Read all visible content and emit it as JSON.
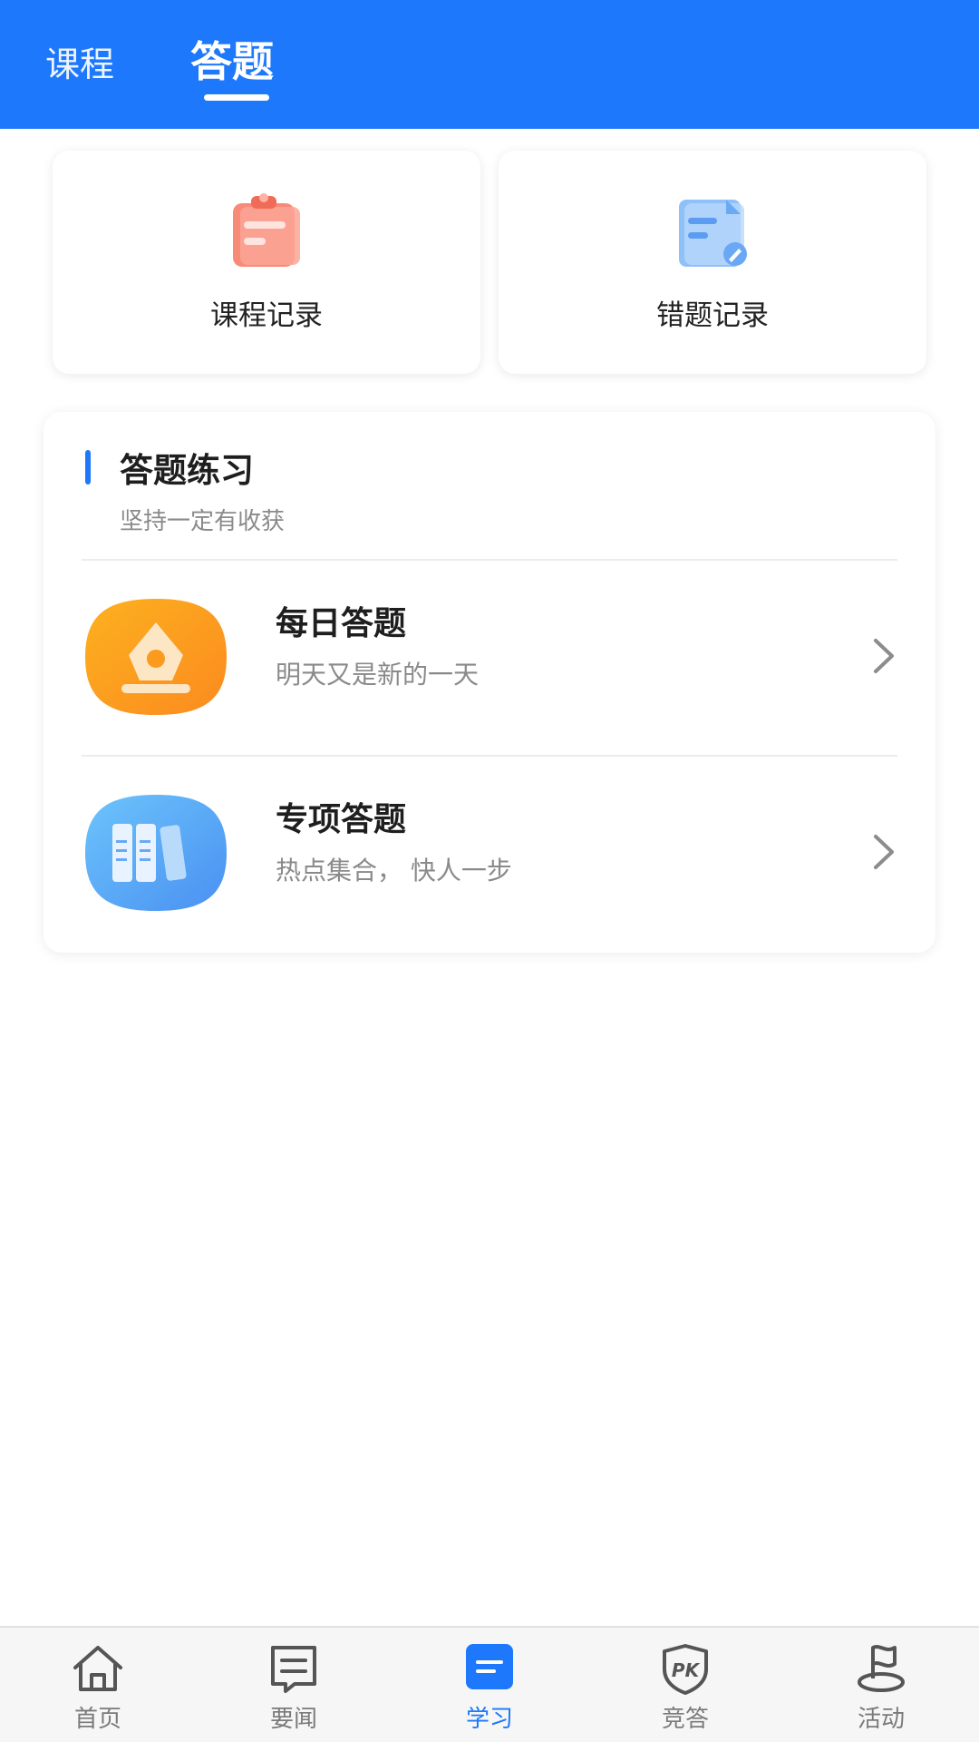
{
  "header": {
    "tabs": [
      {
        "label": "课程",
        "active": false
      },
      {
        "label": "答题",
        "active": true
      }
    ]
  },
  "records": [
    {
      "label": "课程记录",
      "icon": "clipboard-icon"
    },
    {
      "label": "错题记录",
      "icon": "document-edit-icon"
    }
  ],
  "practice": {
    "title": "答题练习",
    "subtitle": "坚持一定有收获",
    "items": [
      {
        "title": "每日答题",
        "desc": "明天又是新的一天",
        "icon": "pen-nib-icon"
      },
      {
        "title": "专项答题",
        "desc": "热点集合， 快人一步",
        "icon": "books-icon"
      }
    ]
  },
  "bottom_nav": {
    "items": [
      {
        "label": "首页",
        "icon": "home-icon",
        "active": false
      },
      {
        "label": "要闻",
        "icon": "news-icon",
        "active": false
      },
      {
        "label": "学习",
        "icon": "study-icon",
        "active": true
      },
      {
        "label": "竞答",
        "icon": "pk-shield-icon",
        "active": false
      },
      {
        "label": "活动",
        "icon": "flag-icon",
        "active": false
      }
    ]
  },
  "colors": {
    "primary": "#1d78fb",
    "text_dark": "#1e1e1e",
    "text_muted": "#8a8a8a",
    "daily_orange": "#fb9a1c",
    "special_blue": "#5aaaf6",
    "record_red": "#f77d6a",
    "record_blue": "#6ba9f5"
  }
}
